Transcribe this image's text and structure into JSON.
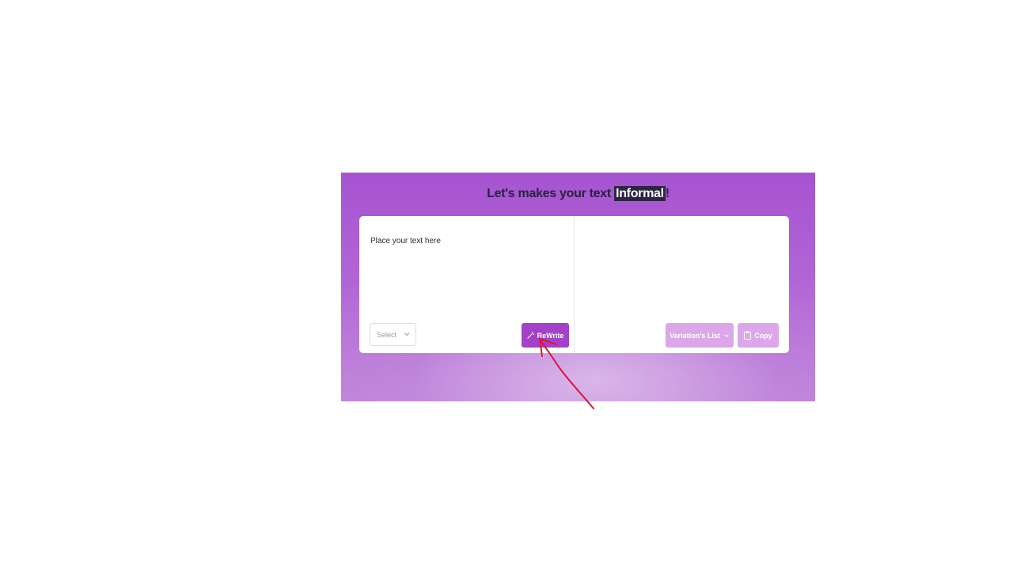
{
  "header": {
    "title_prefix": "Let's makes your text ",
    "title_highlight": "Informal",
    "title_suffix": "!"
  },
  "editor": {
    "input_placeholder": "Place your text here",
    "input_value": "",
    "select_value": "Select"
  },
  "buttons": {
    "rewrite_label": "ReWrite",
    "variation_label": "Variation's List",
    "copy_label": "Copy"
  },
  "icons": {
    "rewrite": "magic-wand-icon",
    "variation": "chevron-down-icon",
    "copy": "clipboard-icon",
    "select": "chevron-down-icon"
  },
  "colors": {
    "banner": "#a653d1",
    "rewrite_button": "#a142c7",
    "disabled_button": "#dca7e8",
    "highlight_bg": "#2e2545",
    "annotation_arrow": "#d8173f"
  }
}
